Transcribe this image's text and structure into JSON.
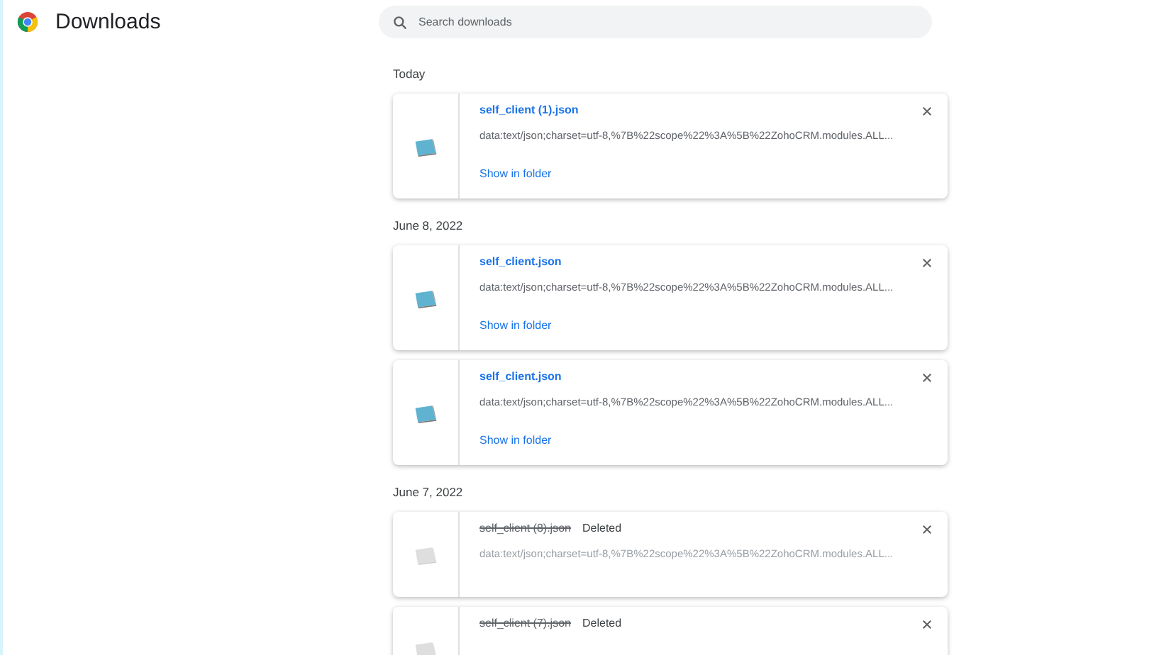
{
  "header": {
    "title": "Downloads"
  },
  "search": {
    "placeholder": "Search downloads"
  },
  "groups": [
    {
      "date": "Today",
      "items": [
        {
          "name": "self_client (1).json",
          "url": "data:text/json;charset=utf-8,%7B%22scope%22%3A%5B%22ZohoCRM.modules.ALL...",
          "deleted": false,
          "action": "Show in folder"
        }
      ]
    },
    {
      "date": "June 8, 2022",
      "items": [
        {
          "name": "self_client.json",
          "url": "data:text/json;charset=utf-8,%7B%22scope%22%3A%5B%22ZohoCRM.modules.ALL...",
          "deleted": false,
          "action": "Show in folder"
        },
        {
          "name": "self_client.json",
          "url": "data:text/json;charset=utf-8,%7B%22scope%22%3A%5B%22ZohoCRM.modules.ALL...",
          "deleted": false,
          "action": "Show in folder"
        }
      ]
    },
    {
      "date": "June 7, 2022",
      "items": [
        {
          "name": "self_client (8).json",
          "url": "data:text/json;charset=utf-8,%7B%22scope%22%3A%5B%22ZohoCRM.modules.ALL...",
          "deleted": true,
          "status": "Deleted"
        },
        {
          "name": "self_client (7).json",
          "deleted": true,
          "status": "Deleted"
        }
      ]
    }
  ]
}
